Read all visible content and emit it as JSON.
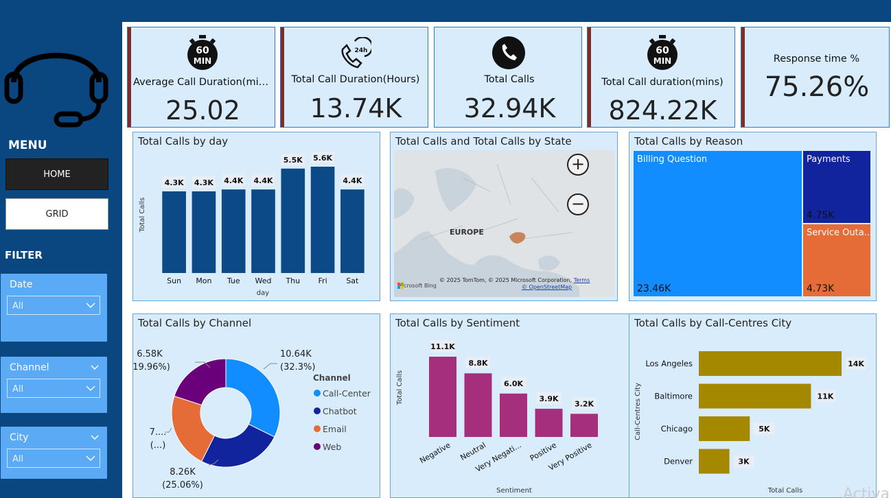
{
  "sidebar": {
    "menu_title": "MENU",
    "nav": [
      {
        "label": "HOME"
      },
      {
        "label": "GRID"
      }
    ],
    "filter_title": "FILTER",
    "slicers": [
      {
        "label": "Date",
        "value": "All"
      },
      {
        "label": "Channel",
        "value": "All"
      },
      {
        "label": "City",
        "value": "All"
      }
    ]
  },
  "kpis": [
    {
      "label": "Average Call Duration(mins)",
      "value": "25.02",
      "icon": "stopwatch-60-min-icon",
      "icon_text": "60",
      "icon_sub": "MIN"
    },
    {
      "label": "Total Call Duration(Hours)",
      "value": "13.74K",
      "icon": "phone-24h-icon",
      "icon_text": "24h"
    },
    {
      "label": "Total Calls",
      "value": "32.94K",
      "icon": "phone-circle-icon"
    },
    {
      "label": "Total Call duration(mins)",
      "value": "824.22K",
      "icon": "stopwatch-60-min-icon",
      "icon_text": "60",
      "icon_sub": "MIN"
    },
    {
      "label": "Response time %",
      "value": "75.26%"
    }
  ],
  "panels": {
    "by_day": {
      "title": "Total Calls by day"
    },
    "by_state": {
      "title": "Total Calls and Total Calls by State"
    },
    "by_reason": {
      "title": "Total Calls by Reason"
    },
    "by_channel": {
      "title": "Total Calls by Channel"
    },
    "by_sentiment": {
      "title": "Total Calls by Sentiment"
    },
    "by_city": {
      "title": "Total Calls by Call-Centres City"
    }
  },
  "map": {
    "region_label": "EUROPE",
    "attribution": "© 2025 TomTom, © 2025 Microsoft Corporation,",
    "terms": "Terms",
    "osm": "© OpenStreetMap",
    "brand": "Microsoft Bing",
    "zoom_in": "+",
    "zoom_out": "−"
  },
  "watermark": "Activa",
  "chart_data": [
    {
      "type": "bar",
      "id": "by_day",
      "title": "Total Calls by day",
      "xlabel": "day",
      "ylabel": "Total Calls",
      "categories": [
        "Sun",
        "Mon",
        "Tue",
        "Wed",
        "Thu",
        "Fri",
        "Sat"
      ],
      "values": [
        4300,
        4300,
        4400,
        4400,
        5500,
        5600,
        4400
      ],
      "labels": [
        "4.3K",
        "4.3K",
        "4.4K",
        "4.4K",
        "5.5K",
        "5.6K",
        "4.4K"
      ],
      "color": "#0b4a86"
    },
    {
      "type": "treemap",
      "id": "by_reason",
      "title": "Total Calls by Reason",
      "items": [
        {
          "name": "Billing Question",
          "value": 23460,
          "label": "23.46K",
          "color": "#118dff"
        },
        {
          "name": "Payments",
          "value": 4750,
          "label": "4.75K",
          "color": "#12239e"
        },
        {
          "name": "Service Outa...",
          "value": 4730,
          "label": "4.73K",
          "color": "#e66c37"
        }
      ]
    },
    {
      "type": "pie",
      "id": "by_channel",
      "title": "Total Calls by Channel",
      "legend_title": "Channel",
      "slices": [
        {
          "name": "Call-Center",
          "value": 10640,
          "label": "10.64K",
          "pct": "(32.3%)",
          "color": "#118dff"
        },
        {
          "name": "Chatbot",
          "value": 8260,
          "label": "8.26K",
          "pct": "(25.06%)",
          "color": "#12239e"
        },
        {
          "name": "Email",
          "value": 7460,
          "label": "7....",
          "pct": "(...)",
          "color": "#e66c37"
        },
        {
          "name": "Web",
          "value": 6580,
          "label": "6.58K",
          "pct": "(19.96%)",
          "color": "#6b007b"
        }
      ]
    },
    {
      "type": "bar",
      "id": "by_sentiment",
      "title": "Total Calls by Sentiment",
      "xlabel": "Sentiment",
      "ylabel": "Total Calls",
      "categories": [
        "Negative",
        "Neutral",
        "Very Negati...",
        "Positive",
        "Very Positive"
      ],
      "values": [
        11100,
        8800,
        6000,
        3900,
        3200
      ],
      "labels": [
        "11.1K",
        "8.8K",
        "6.0K",
        "3.9K",
        "3.2K"
      ],
      "color": "#a62f7d"
    },
    {
      "type": "bar",
      "orientation": "horizontal",
      "id": "by_city",
      "title": "Total Calls by Call-Centres City",
      "xlabel": "Total Calls",
      "ylabel": "Call-Centres City",
      "categories": [
        "Los Angeles",
        "Baltimore",
        "Chicago",
        "Denver"
      ],
      "values": [
        14000,
        11000,
        5000,
        3000
      ],
      "labels": [
        "14K",
        "11K",
        "5K",
        "3K"
      ],
      "color": "#a48800"
    }
  ]
}
